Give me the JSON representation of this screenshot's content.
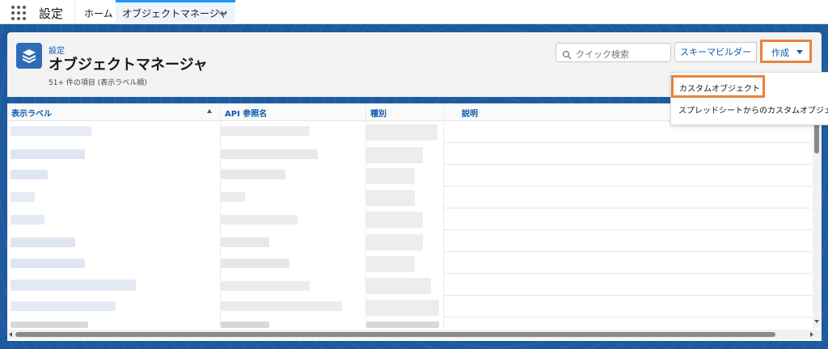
{
  "nav": {
    "app_name": "設定",
    "tabs": [
      {
        "label": "ホーム"
      },
      {
        "label": "オブジェクトマネージャ"
      }
    ]
  },
  "header": {
    "breadcrumb": "設定",
    "title": "オブジェクトマネージャ",
    "item_count": "51+ 件の項目 (表示ラベル順)",
    "search_placeholder": "クイック検索",
    "schema_builder_label": "スキーマビルダー",
    "create_label": "作成"
  },
  "dropdown": {
    "items": [
      "カスタムオブジェクト",
      "スプレッドシートからのカスタムオブジェクト"
    ]
  },
  "table": {
    "columns": [
      "表示ラベル",
      "API 参照名",
      "種別",
      "説明"
    ]
  },
  "colors": {
    "accent": "#0b5cab",
    "highlight": "#e8833a",
    "backdrop": "#1d5a9e"
  }
}
